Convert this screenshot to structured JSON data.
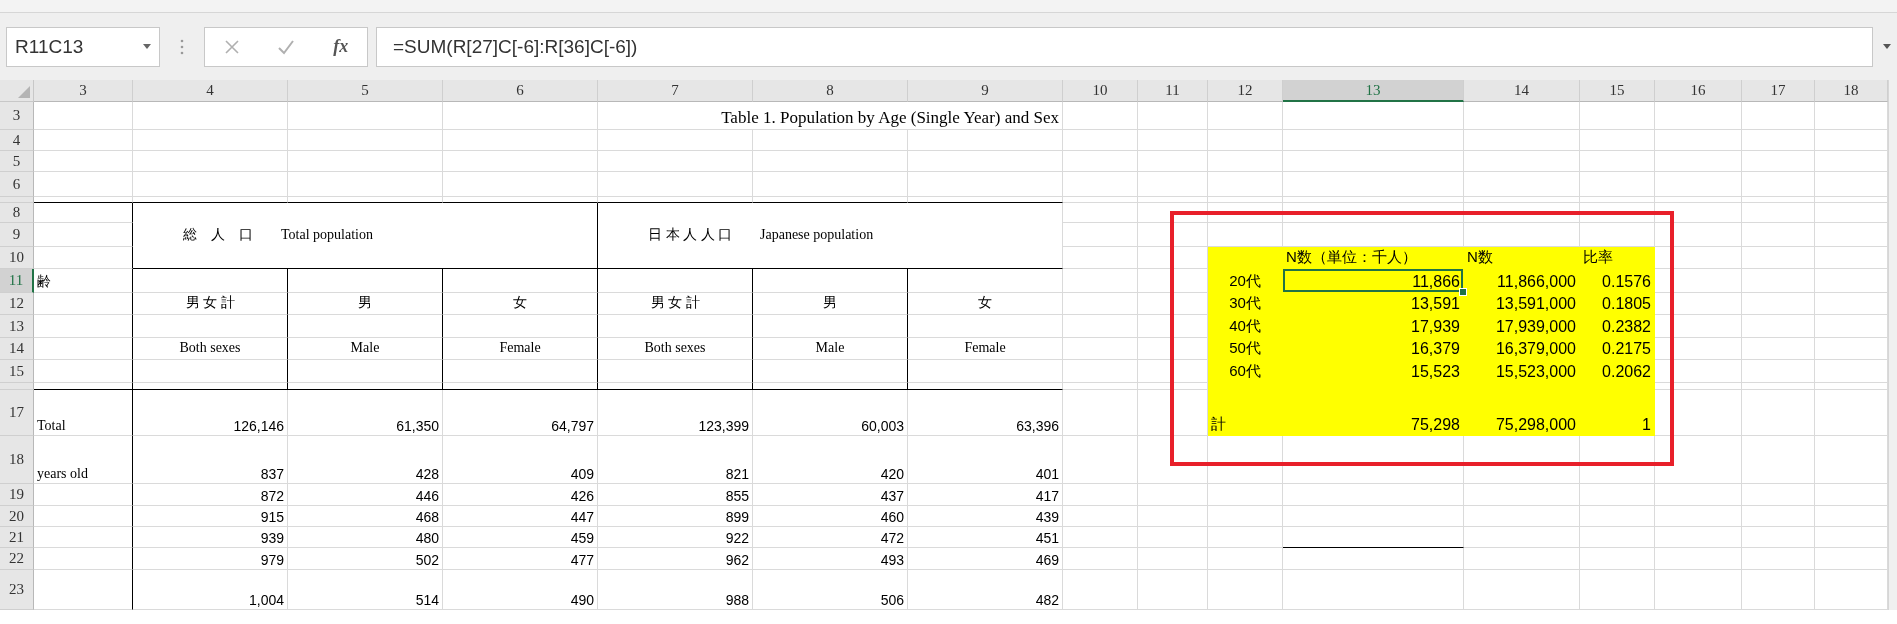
{
  "formula_bar": {
    "name_box": "R11C13",
    "function_label": "fx",
    "formula": "=SUM(R[27]C[-6]:R[36]C[-6])"
  },
  "column_headers": [
    {
      "label": "3",
      "selected": false
    },
    {
      "label": "4",
      "selected": false
    },
    {
      "label": "5",
      "selected": false
    },
    {
      "label": "6",
      "selected": false
    },
    {
      "label": "7",
      "selected": false
    },
    {
      "label": "8",
      "selected": false
    },
    {
      "label": "9",
      "selected": false
    },
    {
      "label": "10",
      "selected": false
    },
    {
      "label": "11",
      "selected": false
    },
    {
      "label": "12",
      "selected": false
    },
    {
      "label": "13",
      "selected": true
    },
    {
      "label": "14",
      "selected": false
    },
    {
      "label": "15",
      "selected": false
    },
    {
      "label": "16",
      "selected": false
    },
    {
      "label": "17",
      "selected": false
    },
    {
      "label": "18",
      "selected": false
    }
  ],
  "row_headers": [
    {
      "label": "3",
      "selected": false
    },
    {
      "label": "4",
      "selected": false
    },
    {
      "label": "5",
      "selected": false
    },
    {
      "label": "6",
      "selected": false
    },
    {
      "label": "8",
      "selected": false
    },
    {
      "label": "9",
      "selected": false
    },
    {
      "label": "10",
      "selected": false
    },
    {
      "label": "11",
      "selected": true
    },
    {
      "label": "12",
      "selected": false
    },
    {
      "label": "13",
      "selected": false
    },
    {
      "label": "14",
      "selected": false
    },
    {
      "label": "15",
      "selected": false
    },
    {
      "label": "17",
      "selected": false
    },
    {
      "label": "18",
      "selected": false
    },
    {
      "label": "19",
      "selected": false
    },
    {
      "label": "20",
      "selected": false
    },
    {
      "label": "21",
      "selected": false
    },
    {
      "label": "22",
      "selected": false
    },
    {
      "label": "23",
      "selected": false
    }
  ],
  "population_table": {
    "title": "Table 1.   Population by Age (Single Year) and Sex",
    "age_label": "齢",
    "groups": [
      {
        "label": "総　人　口　　Total population",
        "columns": [
          {
            "label": "男 女 計",
            "english": "Both sexes"
          },
          {
            "label": "男",
            "english": "Male"
          },
          {
            "label": "女",
            "english": "Female"
          }
        ]
      },
      {
        "label": "日 本 人 人 口　　Japanese population",
        "columns": [
          {
            "label": "男 女 計",
            "english": "Both sexes"
          },
          {
            "label": "男",
            "english": "Male"
          },
          {
            "label": "女",
            "english": "Female"
          }
        ]
      }
    ],
    "total": {
      "label": "Total",
      "values": [
        "126,146",
        "61,350",
        "64,797",
        "123,399",
        "60,003",
        "63,396"
      ]
    },
    "rows": [
      {
        "label": "years old",
        "values": [
          "837",
          "428",
          "409",
          "821",
          "420",
          "401"
        ]
      },
      {
        "values": [
          "872",
          "446",
          "426",
          "855",
          "437",
          "417"
        ]
      },
      {
        "values": [
          "915",
          "468",
          "447",
          "899",
          "460",
          "439"
        ]
      },
      {
        "values": [
          "939",
          "480",
          "459",
          "922",
          "472",
          "451"
        ]
      },
      {
        "values": [
          "979",
          "502",
          "477",
          "962",
          "493",
          "469"
        ]
      },
      {
        "values": [
          "1,004",
          "514",
          "490",
          "988",
          "506",
          "482"
        ]
      }
    ]
  },
  "summary_table": {
    "headers": [
      "N数（単位：千人）",
      "N数",
      "比率"
    ],
    "rows": [
      {
        "label": "20代",
        "values": [
          "11,866",
          "11,866,000",
          "0.1576"
        ]
      },
      {
        "label": "30代",
        "values": [
          "13,591",
          "13,591,000",
          "0.1805"
        ]
      },
      {
        "label": "40代",
        "values": [
          "17,939",
          "17,939,000",
          "0.2382"
        ]
      },
      {
        "label": "50代",
        "values": [
          "16,379",
          "16,379,000",
          "0.2175"
        ]
      },
      {
        "label": "60代",
        "values": [
          "15,523",
          "15,523,000",
          "0.2062"
        ]
      }
    ],
    "total": {
      "label": "計",
      "values": [
        "75,298",
        "75,298,000",
        "1"
      ]
    }
  }
}
